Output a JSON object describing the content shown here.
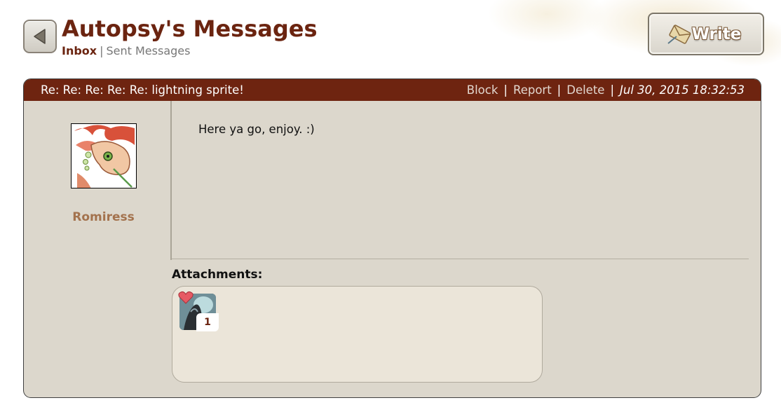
{
  "header": {
    "title": "Autopsy's Messages",
    "nav": {
      "inbox": "Inbox",
      "separator": "|",
      "sent": "Sent Messages"
    },
    "write_label": "Write"
  },
  "message": {
    "subject": "Re: Re: Re: Re: Re: lightning sprite!",
    "actions": {
      "block": "Block",
      "report": "Report",
      "delete": "Delete",
      "separator": "|"
    },
    "date": "Jul 30, 2015 18:32:53",
    "sender": "Romiress",
    "body": "Here ya go, enjoy. :)",
    "attachments_label": "Attachments:",
    "attachments": [
      {
        "icon": "dragon-item-icon",
        "quantity": "1"
      }
    ]
  },
  "colors": {
    "header_bg": "#6e2410",
    "title": "#6b2410",
    "panel_bg": "#dcd7cc",
    "attach_bg": "#ebe5d9",
    "sender_name": "#a3724d"
  }
}
